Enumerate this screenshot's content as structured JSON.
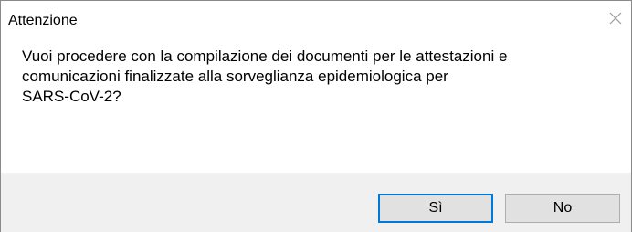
{
  "window": {
    "title": "Attenzione",
    "close_icon": "close-icon"
  },
  "message": "Vuoi procedere con la compilazione dei documenti per le attestazioni e\ncomunicazioni finalizzate alla sorveglianza epidemiologica per\nSARS-CoV-2?",
  "buttons": {
    "yes_label": "Sì",
    "no_label": "No"
  },
  "colors": {
    "accent": "#0078d7",
    "footer_bg": "#f0f0f0",
    "button_bg": "#e1e1e1"
  }
}
